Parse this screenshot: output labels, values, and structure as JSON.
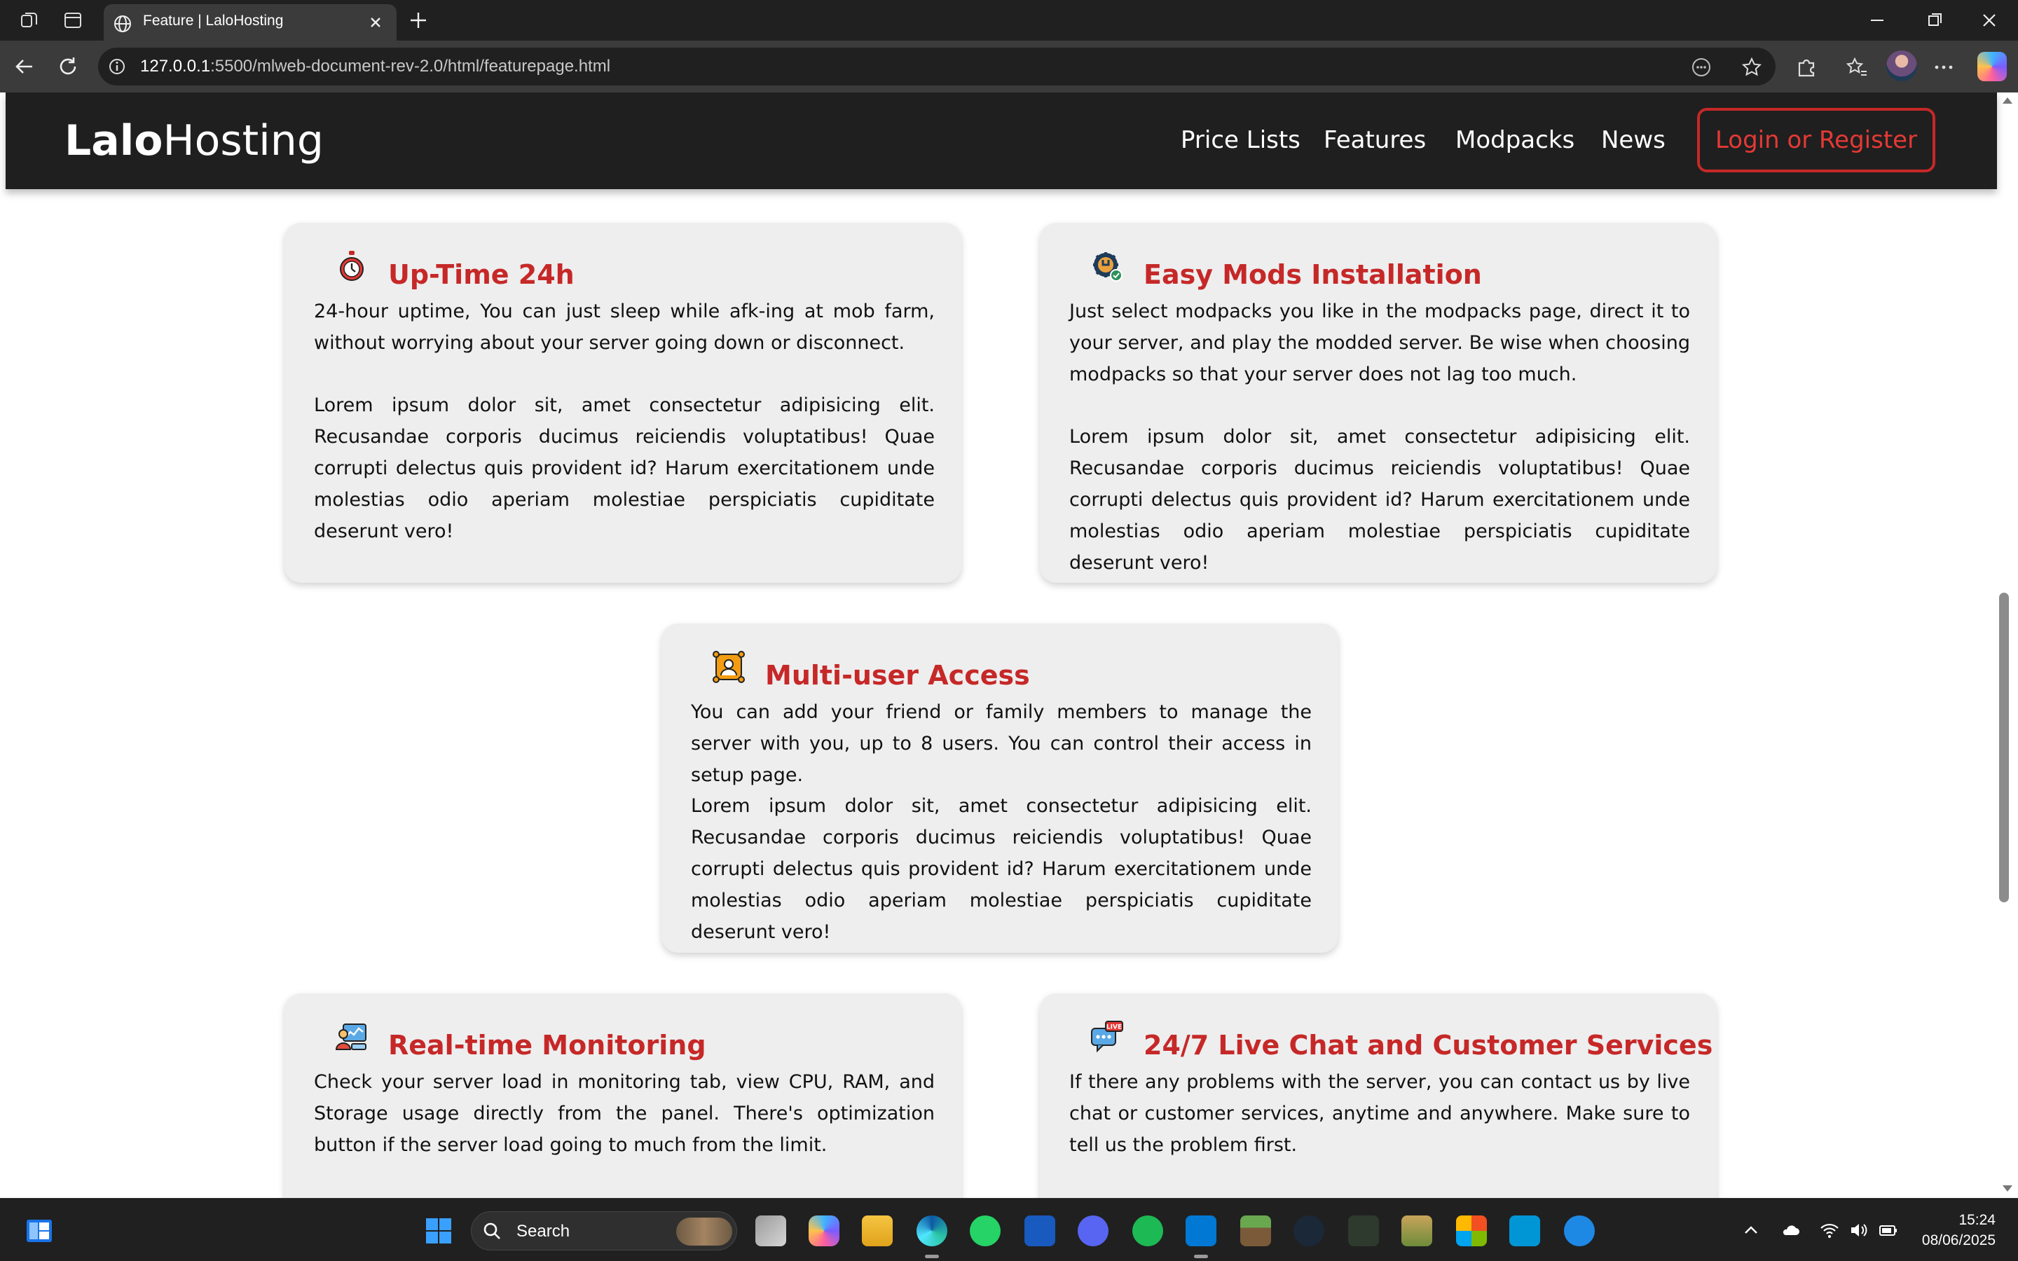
{
  "browser": {
    "tab_title": "Feature | LaloHosting",
    "url_host": "127.0.0.1",
    "url_rest": ":5500/mlweb-document-rev-2.0/html/featurepage.html"
  },
  "site": {
    "logo_bold": "Lalo",
    "logo_light": "Hosting",
    "nav": [
      "Price Lists",
      "Features",
      "Modpacks",
      "News"
    ],
    "login_label": "Login or Register",
    "accent_color": "#c62828"
  },
  "features": [
    {
      "icon": "stopwatch-icon",
      "title": "Up-Time 24h",
      "text1": "24-hour uptime, You can just sleep while afk-ing at mob farm, without worrying about your server going down or disconnect.",
      "text2": "Lorem ipsum dolor sit, amet consectetur adipisicing elit. Recusandae corporis ducimus reiciendis voluptatibus! Quae corrupti delectus quis provident id? Harum exercitationem unde molestias odio aperiam molestiae perspiciatis cupiditate deserunt vero!"
    },
    {
      "icon": "gear-wrench-icon",
      "title": "Easy Mods Installation",
      "text1": "Just select modpacks you like in the modpacks page, direct it to your server, and play the modded server. Be wise when choosing modpacks so that your server does not lag too much.",
      "text2": "Lorem ipsum dolor sit, amet consectetur adipisicing elit. Recusandae corporis ducimus reiciendis voluptatibus! Quae corrupti delectus quis provident id? Harum exercitationem unde molestias odio aperiam molestiae perspiciatis cupiditate deserunt vero!"
    },
    {
      "icon": "multi-user-icon",
      "title": "Multi-user Access",
      "text1": "You can add your friend or family members to manage the server with you, up to 8 users. You can control their access in setup page.",
      "text2": "Lorem ipsum dolor sit, amet consectetur adipisicing elit. Recusandae corporis ducimus reiciendis voluptatibus! Quae corrupti delectus quis provident id? Harum exercitationem unde molestias odio aperiam molestiae perspiciatis cupiditate deserunt vero!"
    },
    {
      "icon": "monitoring-icon",
      "title": "Real-time Monitoring",
      "text1": "Check your server load in monitoring tab, view CPU, RAM, and Storage usage directly from the panel. There's optimization button if the server load going to much from the limit."
    },
    {
      "icon": "live-chat-icon",
      "title": "24/7 Live Chat and Customer Services",
      "badge": "LIVE",
      "text1": "If there any problems with the server, you can contact us by live chat or customer services, anytime and anywhere. Make sure to tell us the problem first."
    }
  ],
  "taskbar": {
    "search_label": "Search",
    "time": "15:24",
    "date": "08/06/2025"
  }
}
